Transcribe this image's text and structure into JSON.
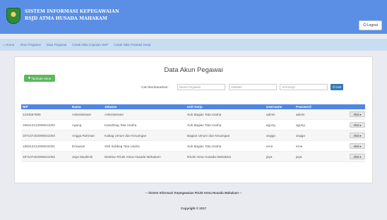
{
  "header": {
    "title_line1": "SISTEM INFORMASI KEPEGAWAIAN",
    "title_line2": "RSJD ATMA HUSADA MAHAKAM",
    "logout_label": "Logout"
  },
  "nav": {
    "items": [
      {
        "label": "Home",
        "icon": "home-icon"
      },
      {
        "label": "Akun Pegawai"
      },
      {
        "label": "Data Pegawai"
      },
      {
        "label": "Cetak Nilai Capaian SKP"
      },
      {
        "label": "Cetak Nilai Prestasi Kerja"
      }
    ]
  },
  "panel": {
    "add_button_label": "Tambah Akun",
    "title": "Data Akun Pegawai",
    "search_label": "Cari Berdasarkan:",
    "search_nama_placeholder": "Nama Pegawai",
    "search_jabatan_placeholder": "Jabatan",
    "search_unit_placeholder": "Unit kerja",
    "search_button_label": "Cari"
  },
  "table": {
    "headers": [
      "NIP",
      "Nama",
      "Jabatan",
      "Unit Kerja",
      "Username",
      "Password",
      ""
    ],
    "action_label": "Aksi",
    "rows": [
      [
        "1234567890",
        "Administrator",
        "Administrator",
        "Sub Bagian Tata Usaha",
        "admin",
        "admin"
      ],
      [
        "196212212006041002",
        "Agung",
        "Kasubbag Tata Usaha",
        "Sub Bagian Tata Usaha",
        "agung",
        "agung"
      ],
      [
        "197107202006041003",
        "Angga Rahman",
        "Kabag Umum dan Keuangan",
        "Bagian Umum dan Keuangan",
        "angga",
        "angga"
      ],
      [
        "196212212006042001",
        "Ernawati",
        "Staf Subbag Tata Usaha",
        "Sub Bagian Tata Usaha",
        "erna",
        "erna"
      ],
      [
        "197107202006041002",
        "Jaya Mualimin",
        "Direktur RSJD Atma Husada Mahakam",
        "RSJD Atma Husada Mahakam",
        "jaya",
        "jaya"
      ]
    ]
  },
  "footer": {
    "line1": "-- Sistem Informasi Kepegawaian RSJD Atma Husada Mahakam --",
    "line2": "Copyright © 2017"
  }
}
